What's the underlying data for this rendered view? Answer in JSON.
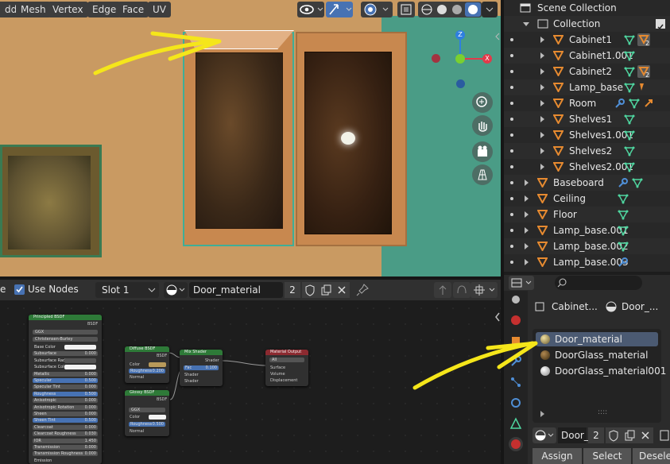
{
  "viewport_header": {
    "mode_partial": "dd",
    "menus": [
      "Mesh",
      "Vertex",
      "Edge",
      "Face",
      "UV"
    ]
  },
  "gizmo": {
    "z": "Z",
    "x": "X"
  },
  "outliner": {
    "title": "Scene Collection",
    "collection": "Collection",
    "items": [
      {
        "label": "Cabinet1",
        "level": 2
      },
      {
        "label": "Cabinet1.001",
        "level": 2
      },
      {
        "label": "Cabinet2",
        "level": 2
      },
      {
        "label": "Lamp_base",
        "level": 2
      },
      {
        "label": "Room",
        "level": 2
      },
      {
        "label": "Shelves1",
        "level": 2
      },
      {
        "label": "Shelves1.001",
        "level": 2
      },
      {
        "label": "Shelves2",
        "level": 2
      },
      {
        "label": "Shelves2.001",
        "level": 2
      },
      {
        "label": "Baseboard",
        "level": 1
      },
      {
        "label": "Ceiling",
        "level": 1
      },
      {
        "label": "Floor",
        "level": 1
      },
      {
        "label": "Lamp_base.001",
        "level": 1
      },
      {
        "label": "Lamp_base.002",
        "level": 1
      },
      {
        "label": "Lamp_base.003",
        "level": 1
      }
    ],
    "badge": "2"
  },
  "node_header": {
    "partial": "e",
    "use_nodes_label": "Use Nodes",
    "slot": "Slot 1",
    "material_name": "Door_material",
    "users": "2"
  },
  "nodes": {
    "principled": {
      "title": "Principled BSDF",
      "out": "BSDF",
      "dist": "GGX",
      "sss": "Christensen-Burley",
      "rows": [
        "Base Color",
        "Subsurface",
        "Subsurface Radius",
        "Subsurface Color",
        "Metallic",
        "Specular",
        "Specular Tint",
        "Roughness",
        "Anisotropic",
        "Anisotropic Rotation",
        "Sheen",
        "Sheen Tint",
        "Clearcoat",
        "Clearcoat Roughness",
        "IOR",
        "Transmission",
        "Transmission Roughness",
        "Emission"
      ],
      "values": {
        "subsurface": "0.000",
        "metallic": "0.000",
        "specular": "0.500",
        "specular_tint": "0.000",
        "roughness": "0.500",
        "aniso": "0.000",
        "aniso_rot": "0.000",
        "sheen": "0.000",
        "sheen_tint": "0.500",
        "clearcoat": "0.000",
        "cc_rough": "0.030",
        "ior": "1.450",
        "trans": "0.000",
        "trans_rough": "0.000"
      }
    },
    "diffuse": {
      "title": "Diffuse BSDF",
      "out": "BSDF",
      "color": "Color",
      "roughness": "Roughness",
      "roughness_val": "0.200",
      "normal": "Normal"
    },
    "glossy": {
      "title": "Glossy BSDF",
      "out": "BSDF",
      "dist": "GGX",
      "color": "Color",
      "roughness": "Roughness",
      "roughness_val": "0.500",
      "normal": "Normal"
    },
    "mix": {
      "title": "Mix Shader",
      "out": "Shader",
      "fac": "Fac",
      "fac_val": "0.100",
      "s1": "Shader",
      "s2": "Shader"
    },
    "output": {
      "title": "Material Output",
      "target": "All",
      "surface": "Surface",
      "volume": "Volume",
      "displacement": "Displacement"
    }
  },
  "properties": {
    "object": "Cabinet...",
    "material": "Door_...",
    "materials": [
      "Door_material",
      "DoorGlass_material",
      "DoorGlass_material001"
    ],
    "selected_index": 0,
    "list_resize": "::::",
    "mat_field": "Door_",
    "users": "2",
    "buttons": [
      "Assign",
      "Select",
      "Desele"
    ]
  },
  "colors": {
    "accent_blue": "#4772b3",
    "annotation_yellow": "#f5e61a",
    "node_green": "#2e7a38",
    "node_red": "#8c2a30",
    "selected_row": "#4b5a72"
  }
}
